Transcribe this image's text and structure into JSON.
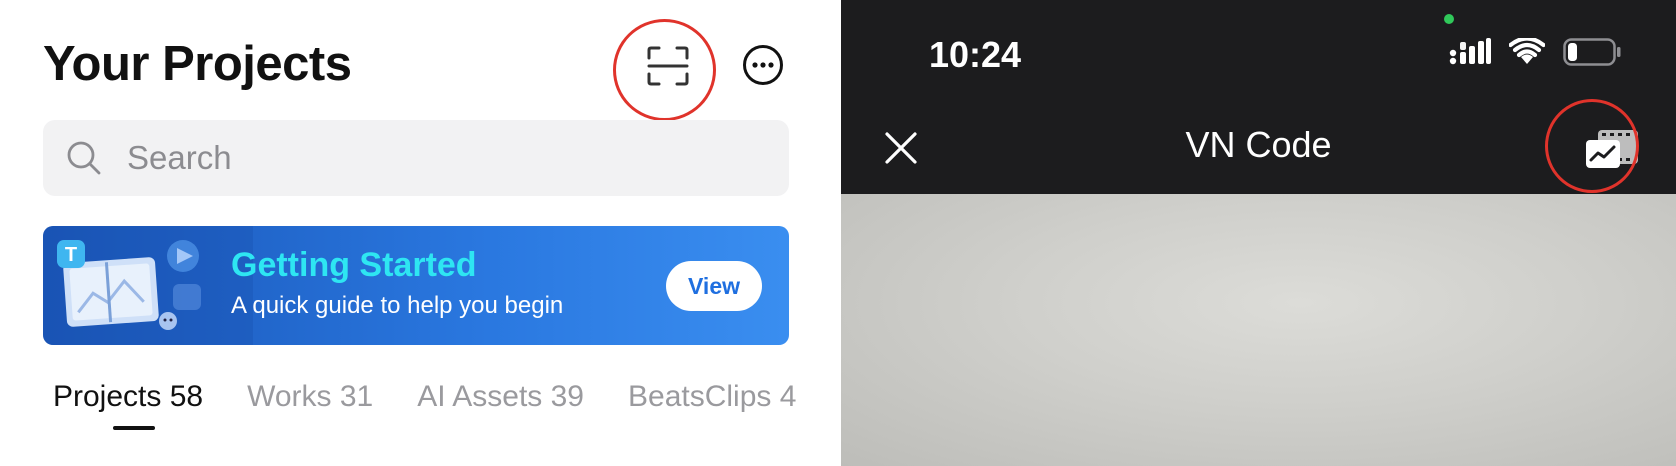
{
  "projects": {
    "title": "Your Projects",
    "search_placeholder": "Search",
    "banner": {
      "title": "Getting Started",
      "subtitle": "A quick guide to help you begin",
      "button_label": "View"
    },
    "tabs": [
      {
        "label": "Projects 58"
      },
      {
        "label": "Works 31"
      },
      {
        "label": "AI Assets 39"
      },
      {
        "label": "BeatsClips 4"
      }
    ],
    "icons": {
      "scan": "scan-qr-icon",
      "more": "more-options-icon",
      "search": "search-icon"
    }
  },
  "scanner": {
    "time": "10:24",
    "title": "VN Code",
    "icons": {
      "close": "close-icon",
      "gallery": "gallery-icon"
    }
  },
  "colors": {
    "highlight": "#e0332b",
    "banner_accent": "#2ee6f2",
    "banner_bg": "#2a78e0",
    "dark_bar": "#1c1c1e"
  }
}
